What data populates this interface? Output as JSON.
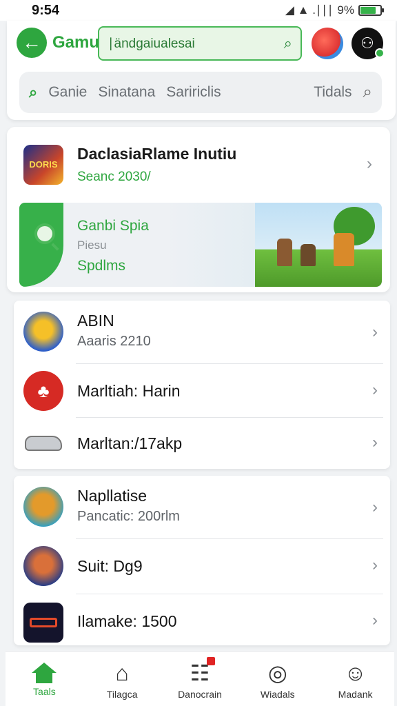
{
  "status_bar": {
    "time": "9:54",
    "battery_text": "9%",
    "signal_text": "◢ ▲ .∣∣∣"
  },
  "header": {
    "title": "Gamu",
    "search_value": "∣ändgaiualesai",
    "filters": [
      "Ganie",
      "Sinatana",
      "Saririclis"
    ],
    "filter_right": "Tidals"
  },
  "featured": {
    "icon_text": "DORIS",
    "title": "DaclasiaRlame Inutiu",
    "subtitle": "Seanc 2030/",
    "banner": {
      "line1": "Ganbi Spia",
      "line2": "Piesu",
      "line3": "Spdlms"
    }
  },
  "list_1": [
    {
      "title": "ABIN",
      "subtitle": "Aaaris 2210",
      "icon": "abin-game-icon"
    },
    {
      "title": "Marltiah: Harin",
      "subtitle": "",
      "icon": "martial-game-icon"
    },
    {
      "title": "Marltan:/17akp",
      "subtitle": "",
      "icon": "car-icon"
    }
  ],
  "list_2": [
    {
      "title": "Napllatise",
      "subtitle": "Pancatic: 200rlm",
      "icon": "naplatise-game-icon"
    },
    {
      "title": "Suit: Dg9",
      "subtitle": "",
      "icon": "suit-game-icon"
    },
    {
      "title": "Ilamake: 1500",
      "subtitle": "",
      "icon": "hamake-game-icon"
    }
  ],
  "bottom_nav": [
    {
      "label": "Taals",
      "icon": "home-icon",
      "active": true
    },
    {
      "label": "Tilagca",
      "icon": "house-outline-icon",
      "active": false
    },
    {
      "label": "Danocrain",
      "icon": "document-icon",
      "active": false,
      "badge": true
    },
    {
      "label": "Wiadals",
      "icon": "badge-icon",
      "active": false
    },
    {
      "label": "Madank",
      "icon": "profile-icon",
      "active": false
    }
  ],
  "colors": {
    "accent": "#2ea63f",
    "badge": "#e02424",
    "background": "#f1f3f5"
  }
}
